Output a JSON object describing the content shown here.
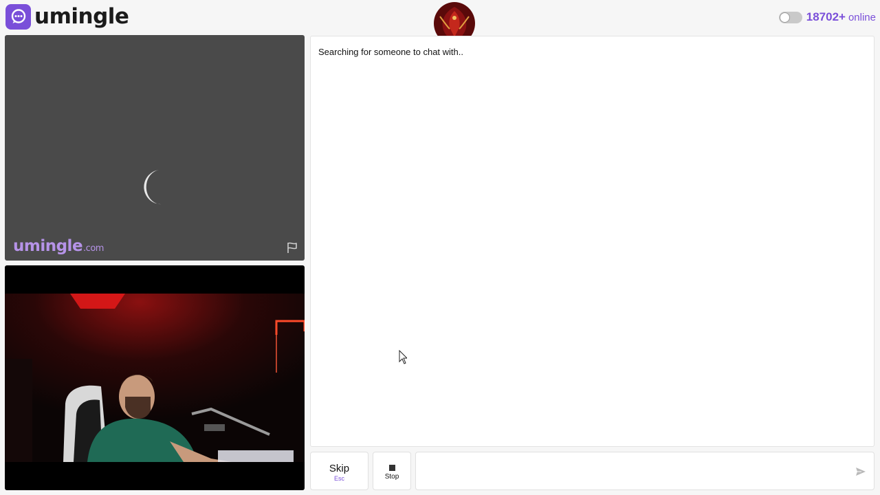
{
  "header": {
    "brand_name": "umingle",
    "online_count": "18702+",
    "online_label": "online"
  },
  "remote_video": {
    "watermark": "umingle",
    "watermark_tld": ".com",
    "report_icon": "flag-icon"
  },
  "chat": {
    "status_message": "Searching for someone to chat with.."
  },
  "controls": {
    "skip_label": "Skip",
    "skip_hint": "Esc",
    "stop_label": "Stop",
    "message_placeholder": "",
    "send_icon": "send-icon"
  },
  "colors": {
    "accent": "#7a4fd9",
    "watermark": "#b693e8",
    "video_bg": "#4a4a4a"
  }
}
